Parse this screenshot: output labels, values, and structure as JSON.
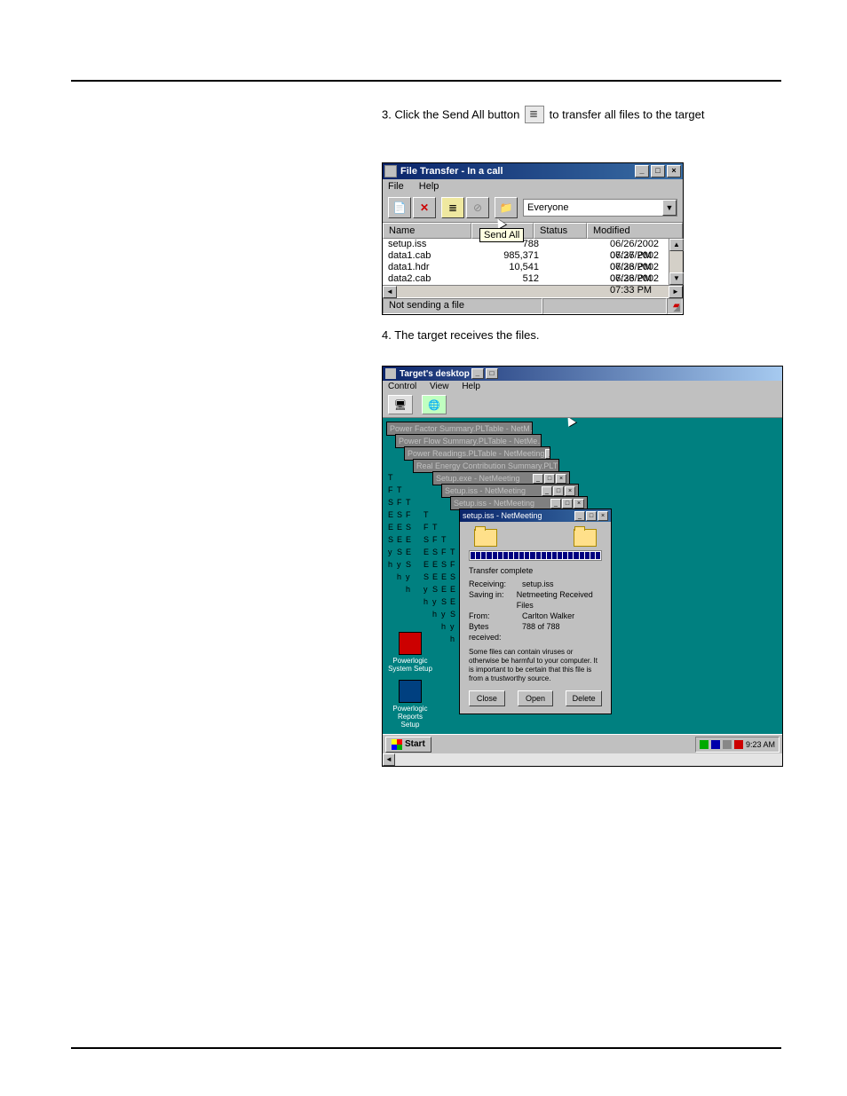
{
  "instructions": {
    "line1_prefix": "3. Click the Send All button",
    "line1_suffix": " to transfer all files to the target"
  },
  "file_transfer": {
    "title": "File Transfer - In a call",
    "menu": {
      "file": "File",
      "help": "Help"
    },
    "tooltip": "Send All",
    "combo_value": "Everyone",
    "columns": {
      "name": "Name",
      "size": "",
      "status": "Status",
      "modified": "Modified"
    },
    "rows": [
      {
        "name": "setup.iss",
        "size": "788",
        "status": "",
        "modified": "06/26/2002 07:37 PM"
      },
      {
        "name": "data1.cab",
        "size": "985,371",
        "status": "",
        "modified": "06/26/2002 07:33 PM"
      },
      {
        "name": "data1.hdr",
        "size": "10,541",
        "status": "",
        "modified": "06/26/2002 07:33 PM"
      },
      {
        "name": "data2.cab",
        "size": "512",
        "status": "",
        "modified": "06/26/2002 07:33 PM"
      }
    ],
    "status_text": "Not sending a file"
  },
  "between_text": "4. The target receives the files.",
  "desktop_share": {
    "title": "Target's desktop",
    "menu": {
      "control": "Control",
      "view": "View",
      "help": "Help"
    },
    "cascade": [
      {
        "title": "Power Factor Summary.PLTable - NetM…"
      },
      {
        "title": "Power Flow Summary.PLTable - NetMe…"
      },
      {
        "title": "Power Readings.PLTable - NetMeeting"
      },
      {
        "title": "Real Energy Contribution Summary.PLT…"
      },
      {
        "title": "Setup.exe - NetMeeting"
      },
      {
        "title": "Setup.iss - NetMeeting"
      },
      {
        "title": "Setup.iss - NetMeeting"
      },
      {
        "title": "setup.iss - NetMeeting"
      }
    ],
    "dialog": {
      "complete": "Transfer complete",
      "receiving_k": "Receiving:",
      "receiving_v": "setup.iss",
      "saving_k": "Saving in:",
      "saving_v": "Netmeeting Received Files",
      "from_k": "From:",
      "from_v": "Carlton Walker",
      "bytes_k": "Bytes received:",
      "bytes_v": "788 of 788",
      "warning": "Some files can contain viruses or otherwise be harmful to your computer. It is important to be certain that this file is from a trustworthy source.",
      "close": "Close",
      "open": "Open",
      "delete": "Delete"
    },
    "icons": {
      "icon1": "Powerlogic System Setup",
      "icon2": "Powerlogic Reports Setup"
    },
    "taskbar": {
      "start": "Start",
      "time": "9:23 AM"
    }
  }
}
